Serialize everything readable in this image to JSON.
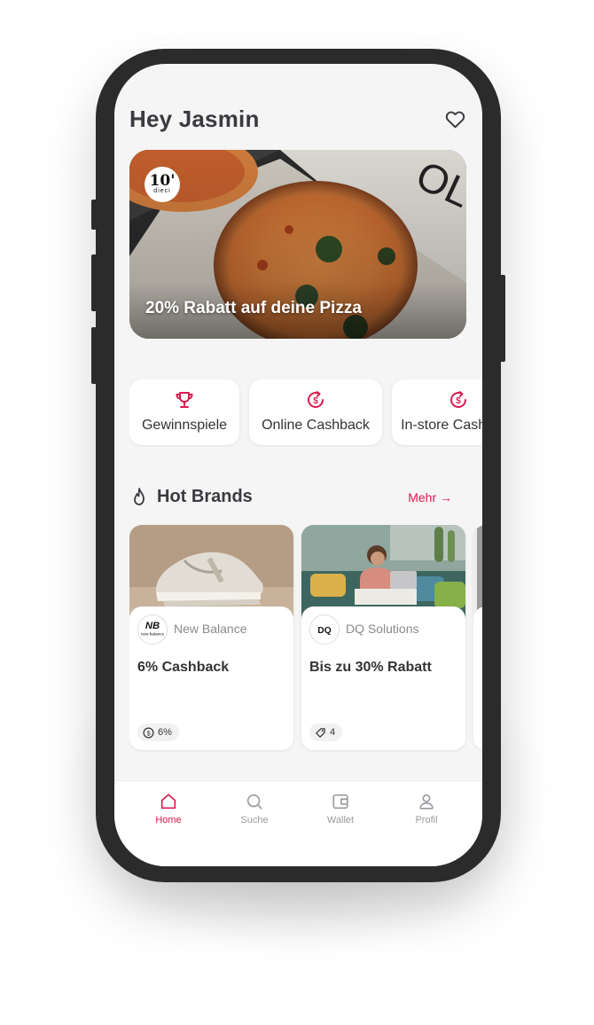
{
  "header": {
    "greeting": "Hey Jasmin"
  },
  "hero": {
    "logo_big": "10'",
    "logo_small": "dieci",
    "title": "20% Rabatt auf deine Pizza"
  },
  "categories": [
    {
      "label": "Gewinnspiele",
      "icon": "trophy-icon"
    },
    {
      "label": "Online Cashback",
      "icon": "cashback-icon"
    },
    {
      "label": "In-store Cashback",
      "icon": "cashback-icon"
    }
  ],
  "hot_brands": {
    "title": "Hot Brands",
    "more": "Mehr →",
    "cards": [
      {
        "brand": "New Balance",
        "logo_text": "new balance",
        "offer": "6% Cashback",
        "chip": "6%",
        "chip_icon": "dollar-icon"
      },
      {
        "brand": "DQ Solutions",
        "logo_text": "DQ",
        "offer": "Bis zu 30% Rabatt",
        "chip": "4",
        "chip_icon": "tag-icon"
      }
    ]
  },
  "nav": [
    {
      "label": "Home",
      "icon": "home-icon",
      "active": true
    },
    {
      "label": "Suche",
      "icon": "search-icon"
    },
    {
      "label": "Wallet",
      "icon": "wallet-icon"
    },
    {
      "label": "Profil",
      "icon": "profile-icon"
    }
  ],
  "colors": {
    "accent": "#d81b4f",
    "text": "#3a3b40",
    "background": "#f5f5f5"
  }
}
